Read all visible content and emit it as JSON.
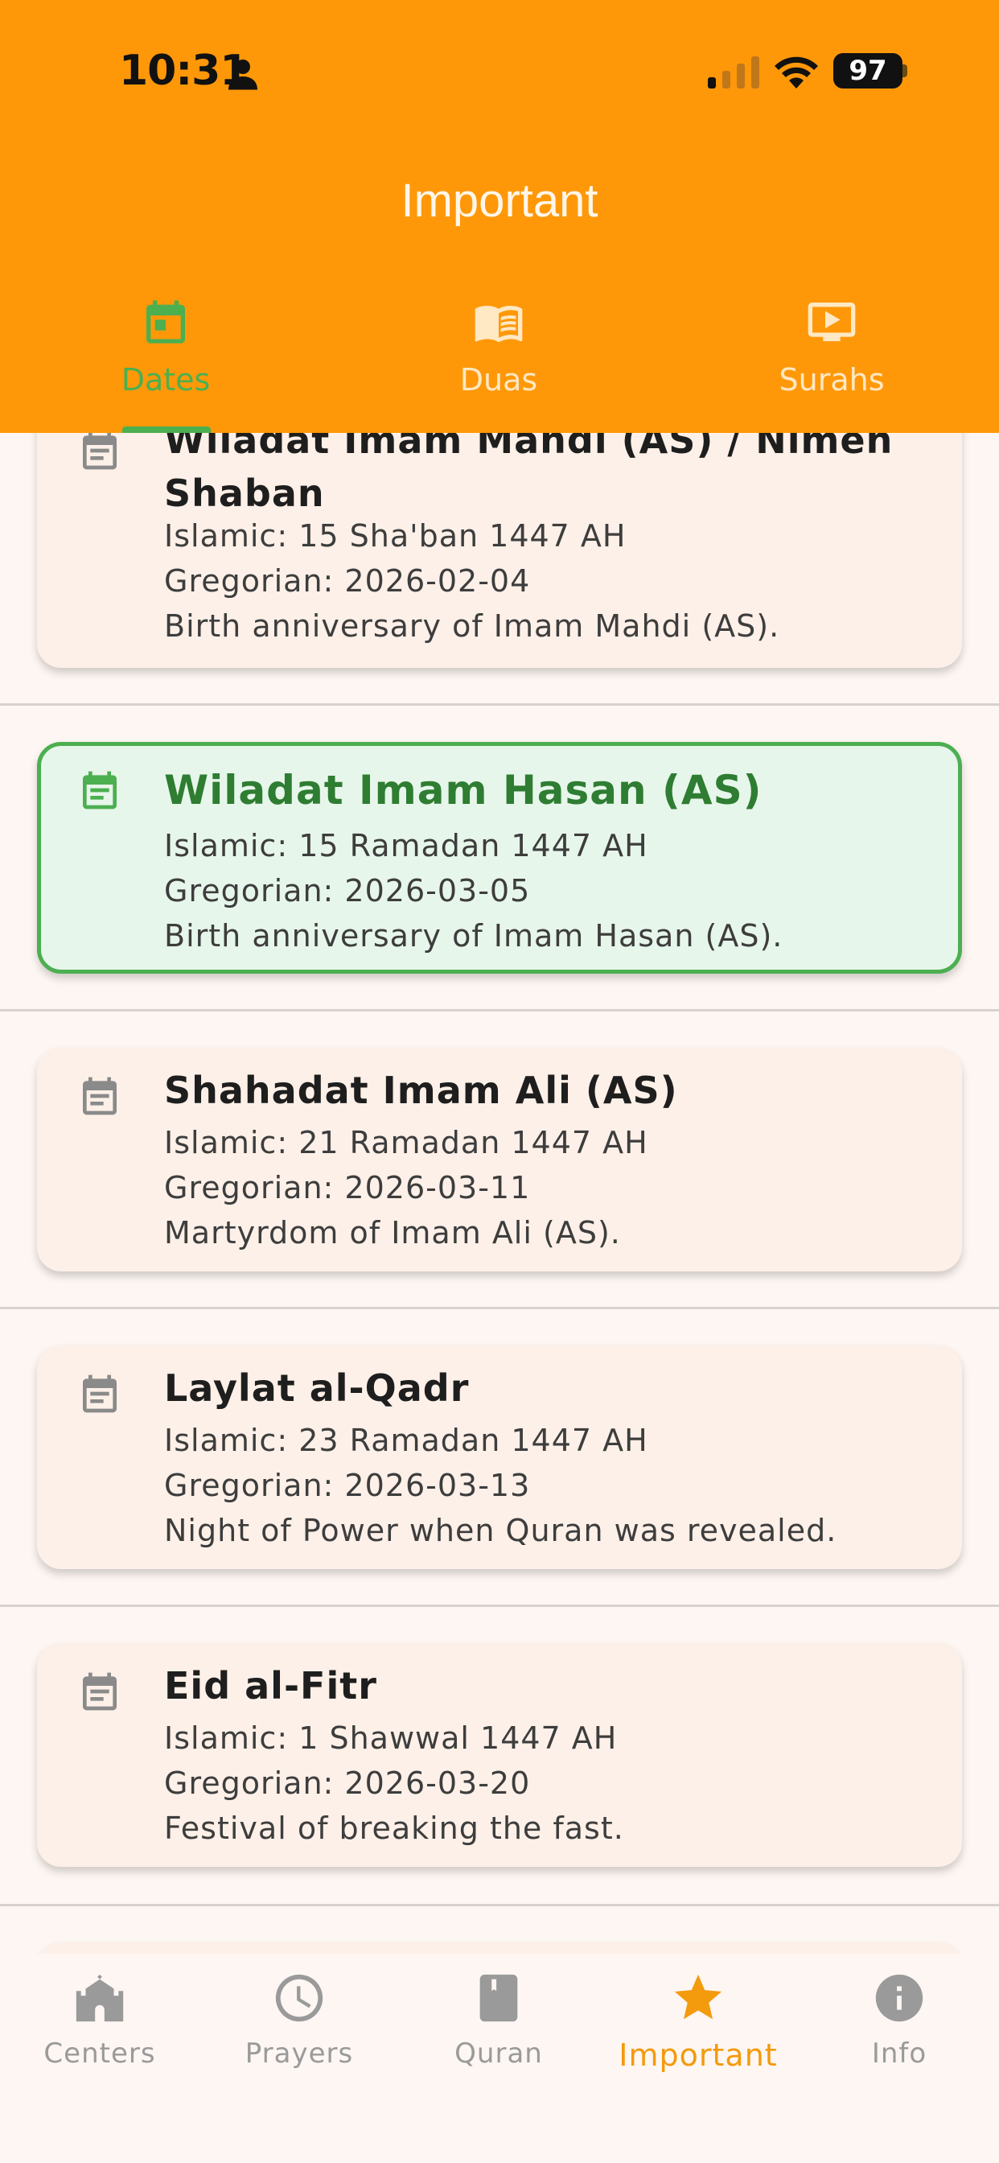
{
  "status_bar": {
    "time": "10:31",
    "battery": "97"
  },
  "header": {
    "title": "Important"
  },
  "tabs": [
    {
      "label": "Dates",
      "active": true
    },
    {
      "label": "Duas",
      "active": false
    },
    {
      "label": "Surahs",
      "active": false
    }
  ],
  "events": [
    {
      "title_line1": "Wiladat Imam Mahdi (AS) / Nimeh",
      "title_line2": "Shaban",
      "islamic": "Islamic: 15 Sha'ban 1447 AH",
      "gregorian": "Gregorian: 2026-02-04",
      "description": "Birth anniversary of Imam Mahdi (AS)."
    },
    {
      "title": "Wiladat Imam Hasan (AS)",
      "islamic": "Islamic: 15 Ramadan 1447 AH",
      "gregorian": "Gregorian: 2026-03-05",
      "description": "Birth anniversary of Imam Hasan (AS).",
      "highlighted": true
    },
    {
      "title": "Shahadat Imam Ali (AS)",
      "islamic": "Islamic: 21 Ramadan 1447 AH",
      "gregorian": "Gregorian: 2026-03-11",
      "description": "Martyrdom of Imam Ali (AS)."
    },
    {
      "title": "Laylat al-Qadr",
      "islamic": "Islamic: 23 Ramadan 1447 AH",
      "gregorian": "Gregorian: 2026-03-13",
      "description": "Night of Power when Quran was revealed."
    },
    {
      "title": "Eid al-Fitr",
      "islamic": "Islamic: 1 Shawwal 1447 AH",
      "gregorian": "Gregorian: 2026-03-20",
      "description": "Festival of breaking the fast."
    }
  ],
  "bottom_nav": [
    {
      "label": "Centers",
      "icon": "mosque-icon"
    },
    {
      "label": "Prayers",
      "icon": "clock-icon"
    },
    {
      "label": "Quran",
      "icon": "book-icon"
    },
    {
      "label": "Important",
      "icon": "star-icon",
      "active": true
    },
    {
      "label": "Info",
      "icon": "info-icon"
    }
  ],
  "colors": {
    "header": "#FF9808",
    "accent_green": "#4CAF50",
    "active_nav": "#F39A0D",
    "card_bg": "#FDF0E8",
    "highlight_bg": "#E7F6EA"
  }
}
